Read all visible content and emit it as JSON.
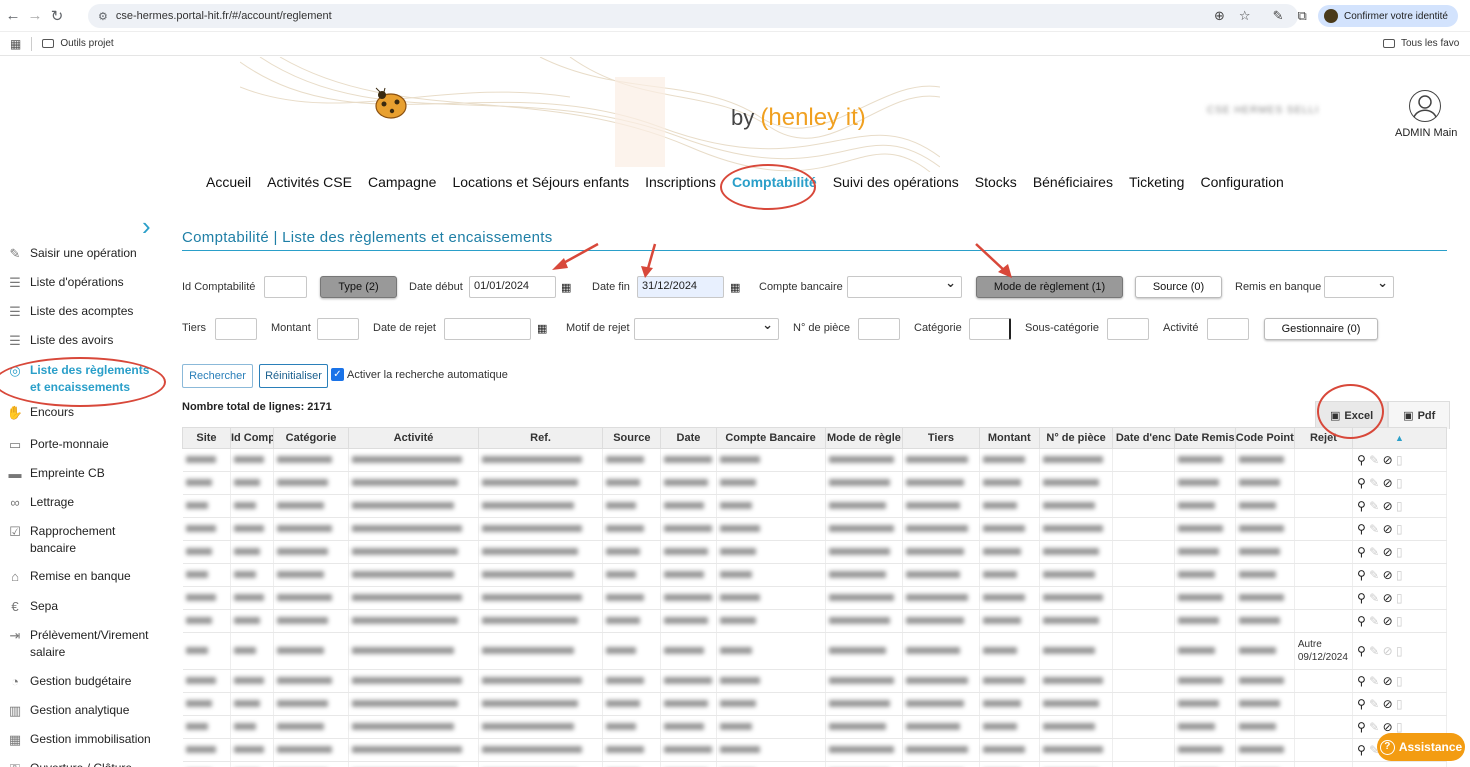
{
  "browser": {
    "url": "cse-hermes.portal-hit.fr/#/account/reglement",
    "identity_label": "Confirmer votre identité",
    "bookmark_folder": "Outils projet",
    "all_favorites": "Tous les favo"
  },
  "header": {
    "brand_by": "by",
    "brand_name": "(henley it)",
    "tenant": "CSE HERMES SELLI",
    "user_name": "ADMIN Main"
  },
  "nav": {
    "items": [
      "Accueil",
      "Activités CSE",
      "Campagne",
      "Locations et Séjours enfants",
      "Inscriptions",
      "Comptabilité",
      "Suivi des opérations",
      "Stocks",
      "Bénéficiaires",
      "Ticketing",
      "Configuration"
    ],
    "active": "Comptabilité"
  },
  "sidebar": {
    "items": [
      {
        "label": "Saisir une opération",
        "icon": "pencil-icon"
      },
      {
        "label": "Liste d'opérations",
        "icon": "list-icon"
      },
      {
        "label": "Liste des acomptes",
        "icon": "list-icon"
      },
      {
        "label": "Liste des avoirs",
        "icon": "list-icon"
      },
      {
        "label": "Liste des règlements et encaissements",
        "icon": "coins-icon"
      },
      {
        "label": "Encours",
        "icon": "hand-icon"
      },
      {
        "label": "Porte-monnaie",
        "icon": "wallet-icon"
      },
      {
        "label": "Empreinte CB",
        "icon": "card-icon"
      },
      {
        "label": "Lettrage",
        "icon": "link-icon"
      },
      {
        "label": "Rapprochement bancaire",
        "icon": "check-square-icon"
      },
      {
        "label": "Remise en banque",
        "icon": "bank-icon"
      },
      {
        "label": "Sepa",
        "icon": "euro-icon"
      },
      {
        "label": "Prélèvement/Virement salaire",
        "icon": "transfer-icon"
      },
      {
        "label": "Gestion budgétaire",
        "icon": "pie-icon"
      },
      {
        "label": "Gestion analytique",
        "icon": "bars-icon"
      },
      {
        "label": "Gestion immobilisation",
        "icon": "building-icon"
      },
      {
        "label": "Ouverture / Clôture",
        "icon": "lock-icon"
      }
    ]
  },
  "page": {
    "title": "Comptabilité | Liste des règlements et encaissements",
    "filters": {
      "id_compta_label": "Id Comptabilité",
      "type_btn": "Type (2)",
      "date_debut_label": "Date début",
      "date_debut": "01/01/2024",
      "date_fin_label": "Date fin",
      "date_fin": "31/12/2024",
      "compte_label": "Compte bancaire",
      "mode_btn": "Mode de règlement (1)",
      "source_btn": "Source (0)",
      "remis_label": "Remis en banque",
      "tiers_label": "Tiers",
      "montant_label": "Montant",
      "date_rejet_label": "Date de rejet",
      "motif_label": "Motif de rejet",
      "piece_label": "N° de pièce",
      "categorie_label": "Catégorie",
      "souscat_label": "Sous-catégorie",
      "activite_label": "Activité",
      "gest_btn": "Gestionnaire (0)"
    },
    "search_btn": "Rechercher",
    "reset_btn": "Réinitialiser",
    "auto_search_label": "Activer la recherche automatique",
    "total_label": "Nombre total de lignes: 2171",
    "excel_label": "Excel",
    "pdf_label": "Pdf"
  },
  "table": {
    "columns": [
      "Site",
      "Id Comp",
      "Catégorie",
      "Activité",
      "Ref.",
      "Source",
      "Date",
      "Compte Bancaire",
      "Mode de règle",
      "Tiers",
      "Montant",
      "N° de pièce",
      "Date d'enc",
      "Date Remis",
      "Code Point",
      "Rejet",
      ""
    ],
    "rejet_row_10_a": "Autre",
    "rejet_row_10_b": "09/12/2024",
    "partial_last": [
      "SC",
      "ESI",
      "24/045",
      "06/ /2024",
      "ASC2/8/12"
    ]
  },
  "assistance": "Assistance",
  "colors": {
    "accent": "#2a9fc9",
    "annotation": "#d8483a",
    "assist": "#f39c12"
  }
}
